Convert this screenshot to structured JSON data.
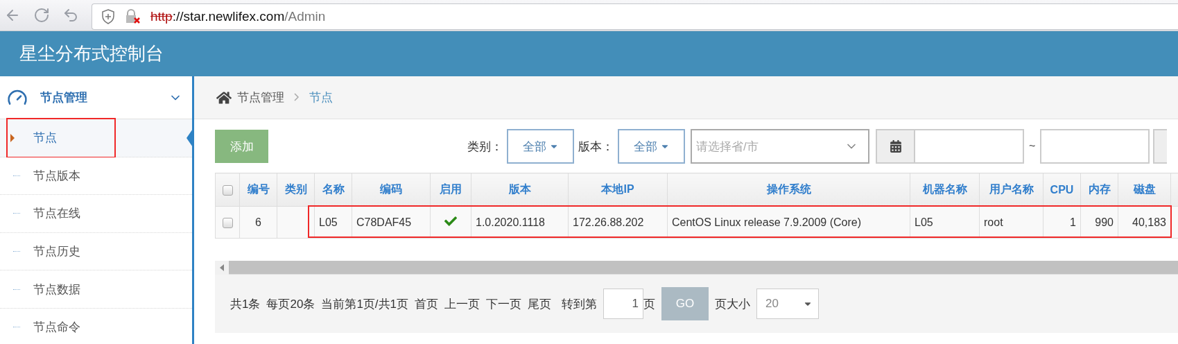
{
  "browser": {
    "url": {
      "scheme": "http",
      "host": "://star.newlifex.com",
      "path": "/Admin"
    }
  },
  "header": {
    "title": "星尘分布式控制台"
  },
  "sidebar": {
    "group": {
      "label": "节点管理",
      "expanded": true
    },
    "items": [
      {
        "label": "节点",
        "selected": true
      },
      {
        "label": "节点版本",
        "selected": false
      },
      {
        "label": "节点在线",
        "selected": false
      },
      {
        "label": "节点历史",
        "selected": false
      },
      {
        "label": "节点数据",
        "selected": false
      },
      {
        "label": "节点命令",
        "selected": false
      }
    ]
  },
  "breadcrumb": [
    "节点管理",
    "节点"
  ],
  "toolbar": {
    "add_button": "添加",
    "filters": [
      {
        "label": "类别：",
        "value": "全部"
      },
      {
        "label": "版本：",
        "value": "全部"
      }
    ],
    "region_select": {
      "placeholder": "请选择省/市"
    },
    "date_separator": "~"
  },
  "table": {
    "header_checked": false,
    "columns": [
      "编号",
      "类别",
      "名称",
      "编码",
      "启用",
      "版本",
      "本地IP",
      "操作系统",
      "机器名称",
      "用户名称",
      "CPU",
      "内存",
      "磁盘"
    ],
    "rows": [
      {
        "checked": false,
        "id": "6",
        "name": "L05",
        "code": "C78DAF45",
        "enabled": true,
        "version": "1.0.2020.1118",
        "ip": "172.26.88.202",
        "os": "CentOS Linux release 7.9.2009 (Core)",
        "machine": "L05",
        "user": "root",
        "cpu": "1",
        "memory": "990",
        "disk": "40,183"
      }
    ]
  },
  "pager": {
    "info": [
      "共1条",
      "每页20条",
      "当前第1页/共1页"
    ],
    "links": [
      "首页",
      "上一页",
      "下一页",
      "尾页"
    ],
    "goto_label": "转到第",
    "page_value": "1",
    "page_suffix": "页",
    "go_button": "GO",
    "size_label": "页大小",
    "size_value": "20"
  }
}
